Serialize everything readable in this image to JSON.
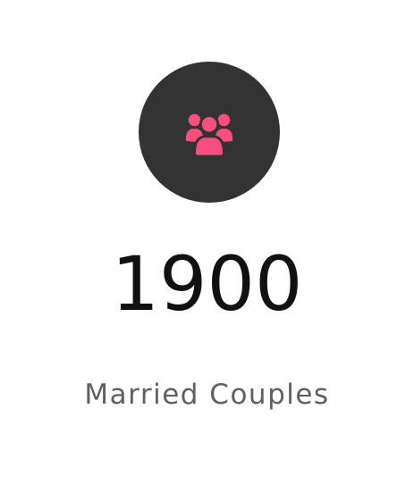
{
  "counter": {
    "value": "1900",
    "label": "Married Couples",
    "icon": "users-group-icon"
  },
  "colors": {
    "circle_background": "#333333",
    "icon": "#f94f7e",
    "value_text": "#111111",
    "label_text": "#606060",
    "page_background": "#ffffff"
  }
}
